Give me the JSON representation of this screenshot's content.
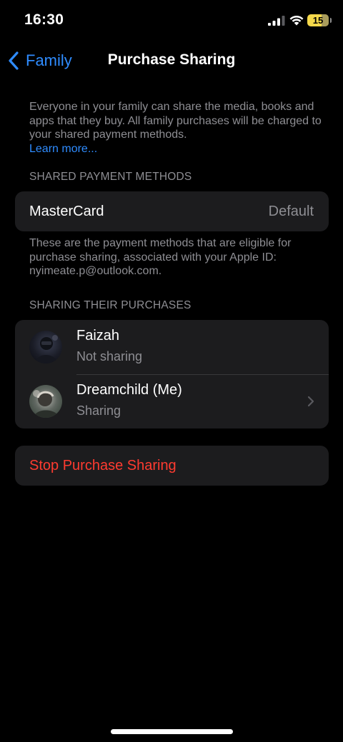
{
  "status_bar": {
    "time": "16:30",
    "battery_level": "15",
    "icons": [
      "signal-icon",
      "wifi-icon",
      "battery-icon"
    ]
  },
  "nav": {
    "back_label": "Family",
    "title": "Purchase Sharing"
  },
  "intro": {
    "text": "Everyone in your family can share the media, books and apps that they buy. All family purchases will be charged to your shared payment methods.",
    "learn_more": "Learn more..."
  },
  "payment_section": {
    "header": "SHARED PAYMENT METHODS",
    "method": {
      "name": "MasterCard",
      "status": "Default"
    },
    "footer": "These are the payment methods that are eligible for purchase sharing, associated with your Apple ID: nyimeate.p@outlook.com."
  },
  "sharing_section": {
    "header": "SHARING THEIR PURCHASES",
    "members": [
      {
        "name": "Faizah",
        "status": "Not sharing"
      },
      {
        "name": "Dreamchild (Me)",
        "status": "Sharing"
      }
    ]
  },
  "stop_action": {
    "label": "Stop Purchase Sharing"
  },
  "colors": {
    "background": "#000000",
    "cell_background": "#1c1c1e",
    "accent_blue": "#2f8cff",
    "destructive_red": "#ff3b30",
    "secondary_text": "#8e8e93",
    "battery_yellow": "#f4d84a"
  }
}
